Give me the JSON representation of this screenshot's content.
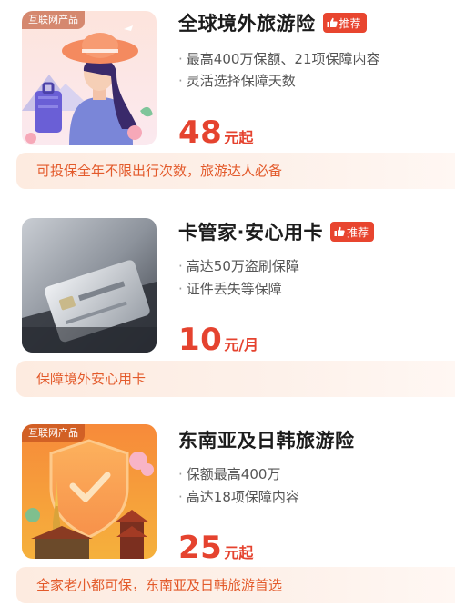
{
  "products": [
    {
      "tag": "互联网产品",
      "title": "全球境外旅游险",
      "badge": "推荐",
      "features": [
        "最高400万保额、21项保障内容",
        "灵活选择保障天数"
      ],
      "price": "48",
      "price_unit": "元起",
      "slogan": "可投保全年不限出行次数，旅游达人必备"
    },
    {
      "title": "卡管家·安心用卡",
      "badge": "推荐",
      "features": [
        "高达50万盗刷保障",
        "证件丢失等保障"
      ],
      "price": "10",
      "price_unit": "元/月",
      "slogan": "保障境外安心用卡"
    },
    {
      "tag": "互联网产品",
      "title": "东南亚及日韩旅游险",
      "features": [
        "保额最高400万",
        "高达18项保障内容"
      ],
      "price": "25",
      "price_unit": "元起",
      "slogan": "全家老小都可保，东南亚及日韩旅游首选"
    }
  ],
  "feature_bullet": "·",
  "colors": {
    "accent": "#e5432f",
    "badge_bg": "#e8452f",
    "slogan_text": "#e35a2b",
    "slogan_bg": "#fdebe0"
  },
  "icons": {
    "badge": "thumbs-up-icon"
  }
}
